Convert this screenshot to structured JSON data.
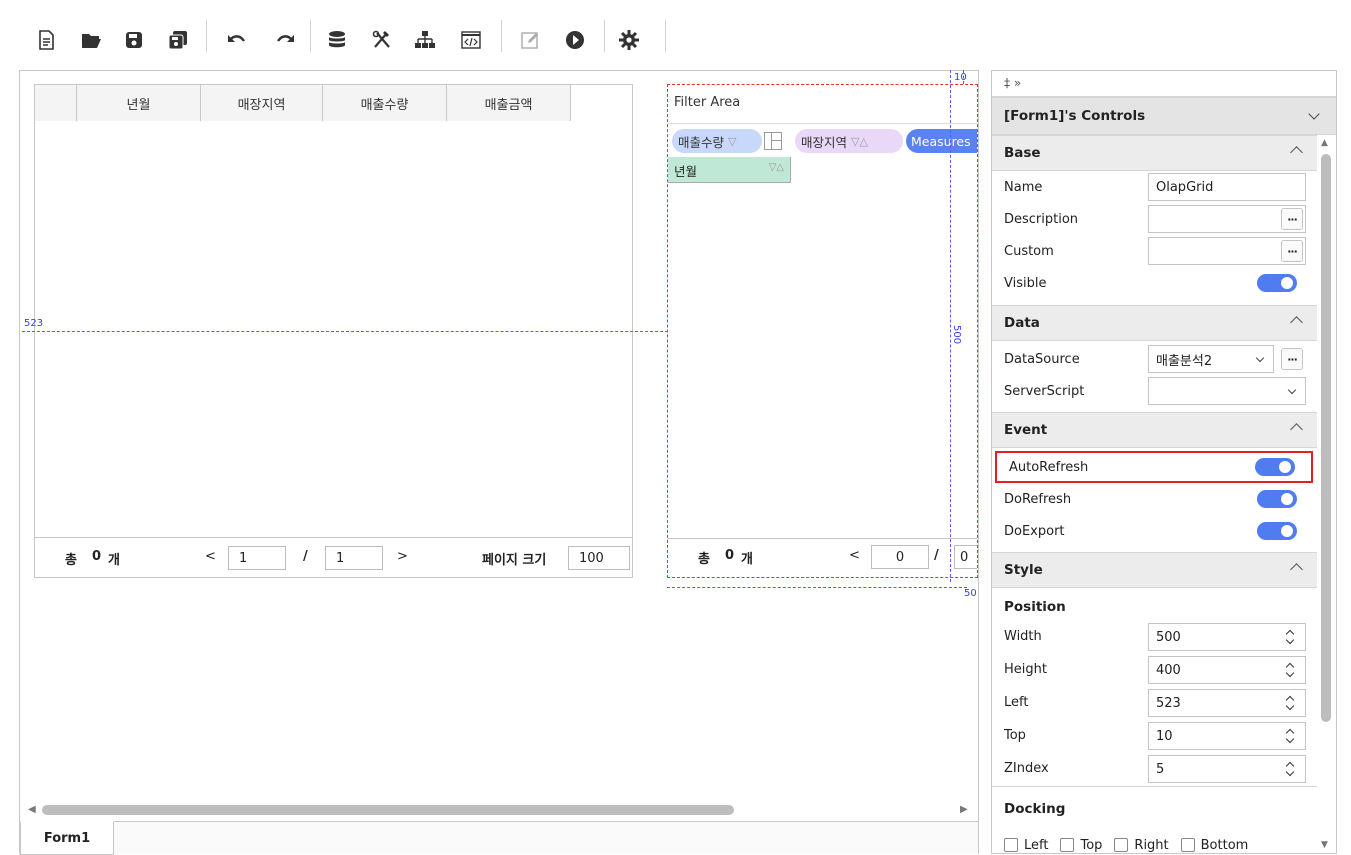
{
  "toolbar": {
    "icons": [
      "new-file-icon",
      "open-folder-icon",
      "save-icon",
      "save-all-icon",
      "undo-icon",
      "redo-icon",
      "database-icon",
      "tools-icon",
      "hierarchy-icon",
      "code-view-icon",
      "edit-icon",
      "run-icon",
      "settings-icon"
    ]
  },
  "grid1": {
    "columns": [
      "",
      "년월",
      "매장지역",
      "매출수량",
      "매출금액"
    ],
    "footer": {
      "total_label": "총",
      "total_count": "0",
      "total_unit": "개",
      "prev": "<",
      "page": "1",
      "slash": "/",
      "page_total": "1",
      "next": ">",
      "page_size_label": "페이지 크기",
      "page_size": "100"
    }
  },
  "grid2": {
    "filter_area": "Filter Area",
    "chip_qty": "매출수량",
    "chip_region": "매장지역",
    "chip_measures": "Measures",
    "row_field": "년월",
    "footer": {
      "total_label": "총",
      "total_count": "0",
      "total_unit": "개",
      "prev": "<",
      "page": "0",
      "slash": "/",
      "page_total": "0"
    }
  },
  "guides": {
    "top_label": "10",
    "left_label": "523",
    "width_label": "500",
    "bottom_label": "50"
  },
  "tabs": {
    "form1": "Form1"
  },
  "panel": {
    "pin_label": "‡ »",
    "title": "[Form1]'s Controls",
    "sections": {
      "base": "Base",
      "data": "Data",
      "event": "Event",
      "style": "Style",
      "position": "Position",
      "docking": "Docking"
    },
    "props": {
      "name_label": "Name",
      "name_value": "OlapGrid",
      "description_label": "Description",
      "custom_label": "Custom",
      "visible_label": "Visible",
      "datasource_label": "DataSource",
      "datasource_value": "매출분석2",
      "serverscript_label": "ServerScript",
      "autorefresh_label": "AutoRefresh",
      "dorefresh_label": "DoRefresh",
      "doexport_label": "DoExport",
      "width_label": "Width",
      "width_value": "500",
      "height_label": "Height",
      "height_value": "400",
      "left_label": "Left",
      "left_value": "523",
      "top_label": "Top",
      "top_value": "10",
      "zindex_label": "ZIndex",
      "zindex_value": "5",
      "dock_left": "Left",
      "dock_top": "Top",
      "dock_right": "Right",
      "dock_bottom": "Bottom"
    },
    "dots": "···",
    "accent": "#4f7df0",
    "highlight": "#e02020"
  }
}
